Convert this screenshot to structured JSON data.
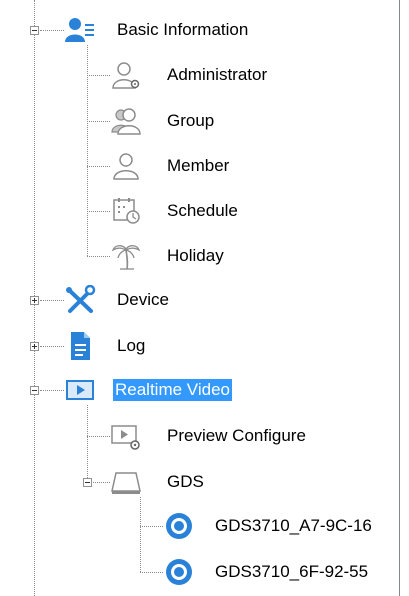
{
  "tree": {
    "basic_information": {
      "label": "Basic Information",
      "children": {
        "administrator": "Administrator",
        "group": "Group",
        "member": "Member",
        "schedule": "Schedule",
        "holiday": "Holiday"
      }
    },
    "device": {
      "label": "Device"
    },
    "log": {
      "label": "Log"
    },
    "realtime_video": {
      "label": "Realtime Video",
      "selected": true,
      "children": {
        "preview_configure": "Preview Configure",
        "gds": {
          "label": "GDS",
          "cameras": [
            "GDS3710_A7-9C-16",
            "GDS3710_6F-92-55"
          ]
        }
      }
    }
  },
  "colors": {
    "selection": "#3399ff",
    "icon_blue": "#2a82d8",
    "icon_gray": "#8c8c8c"
  }
}
